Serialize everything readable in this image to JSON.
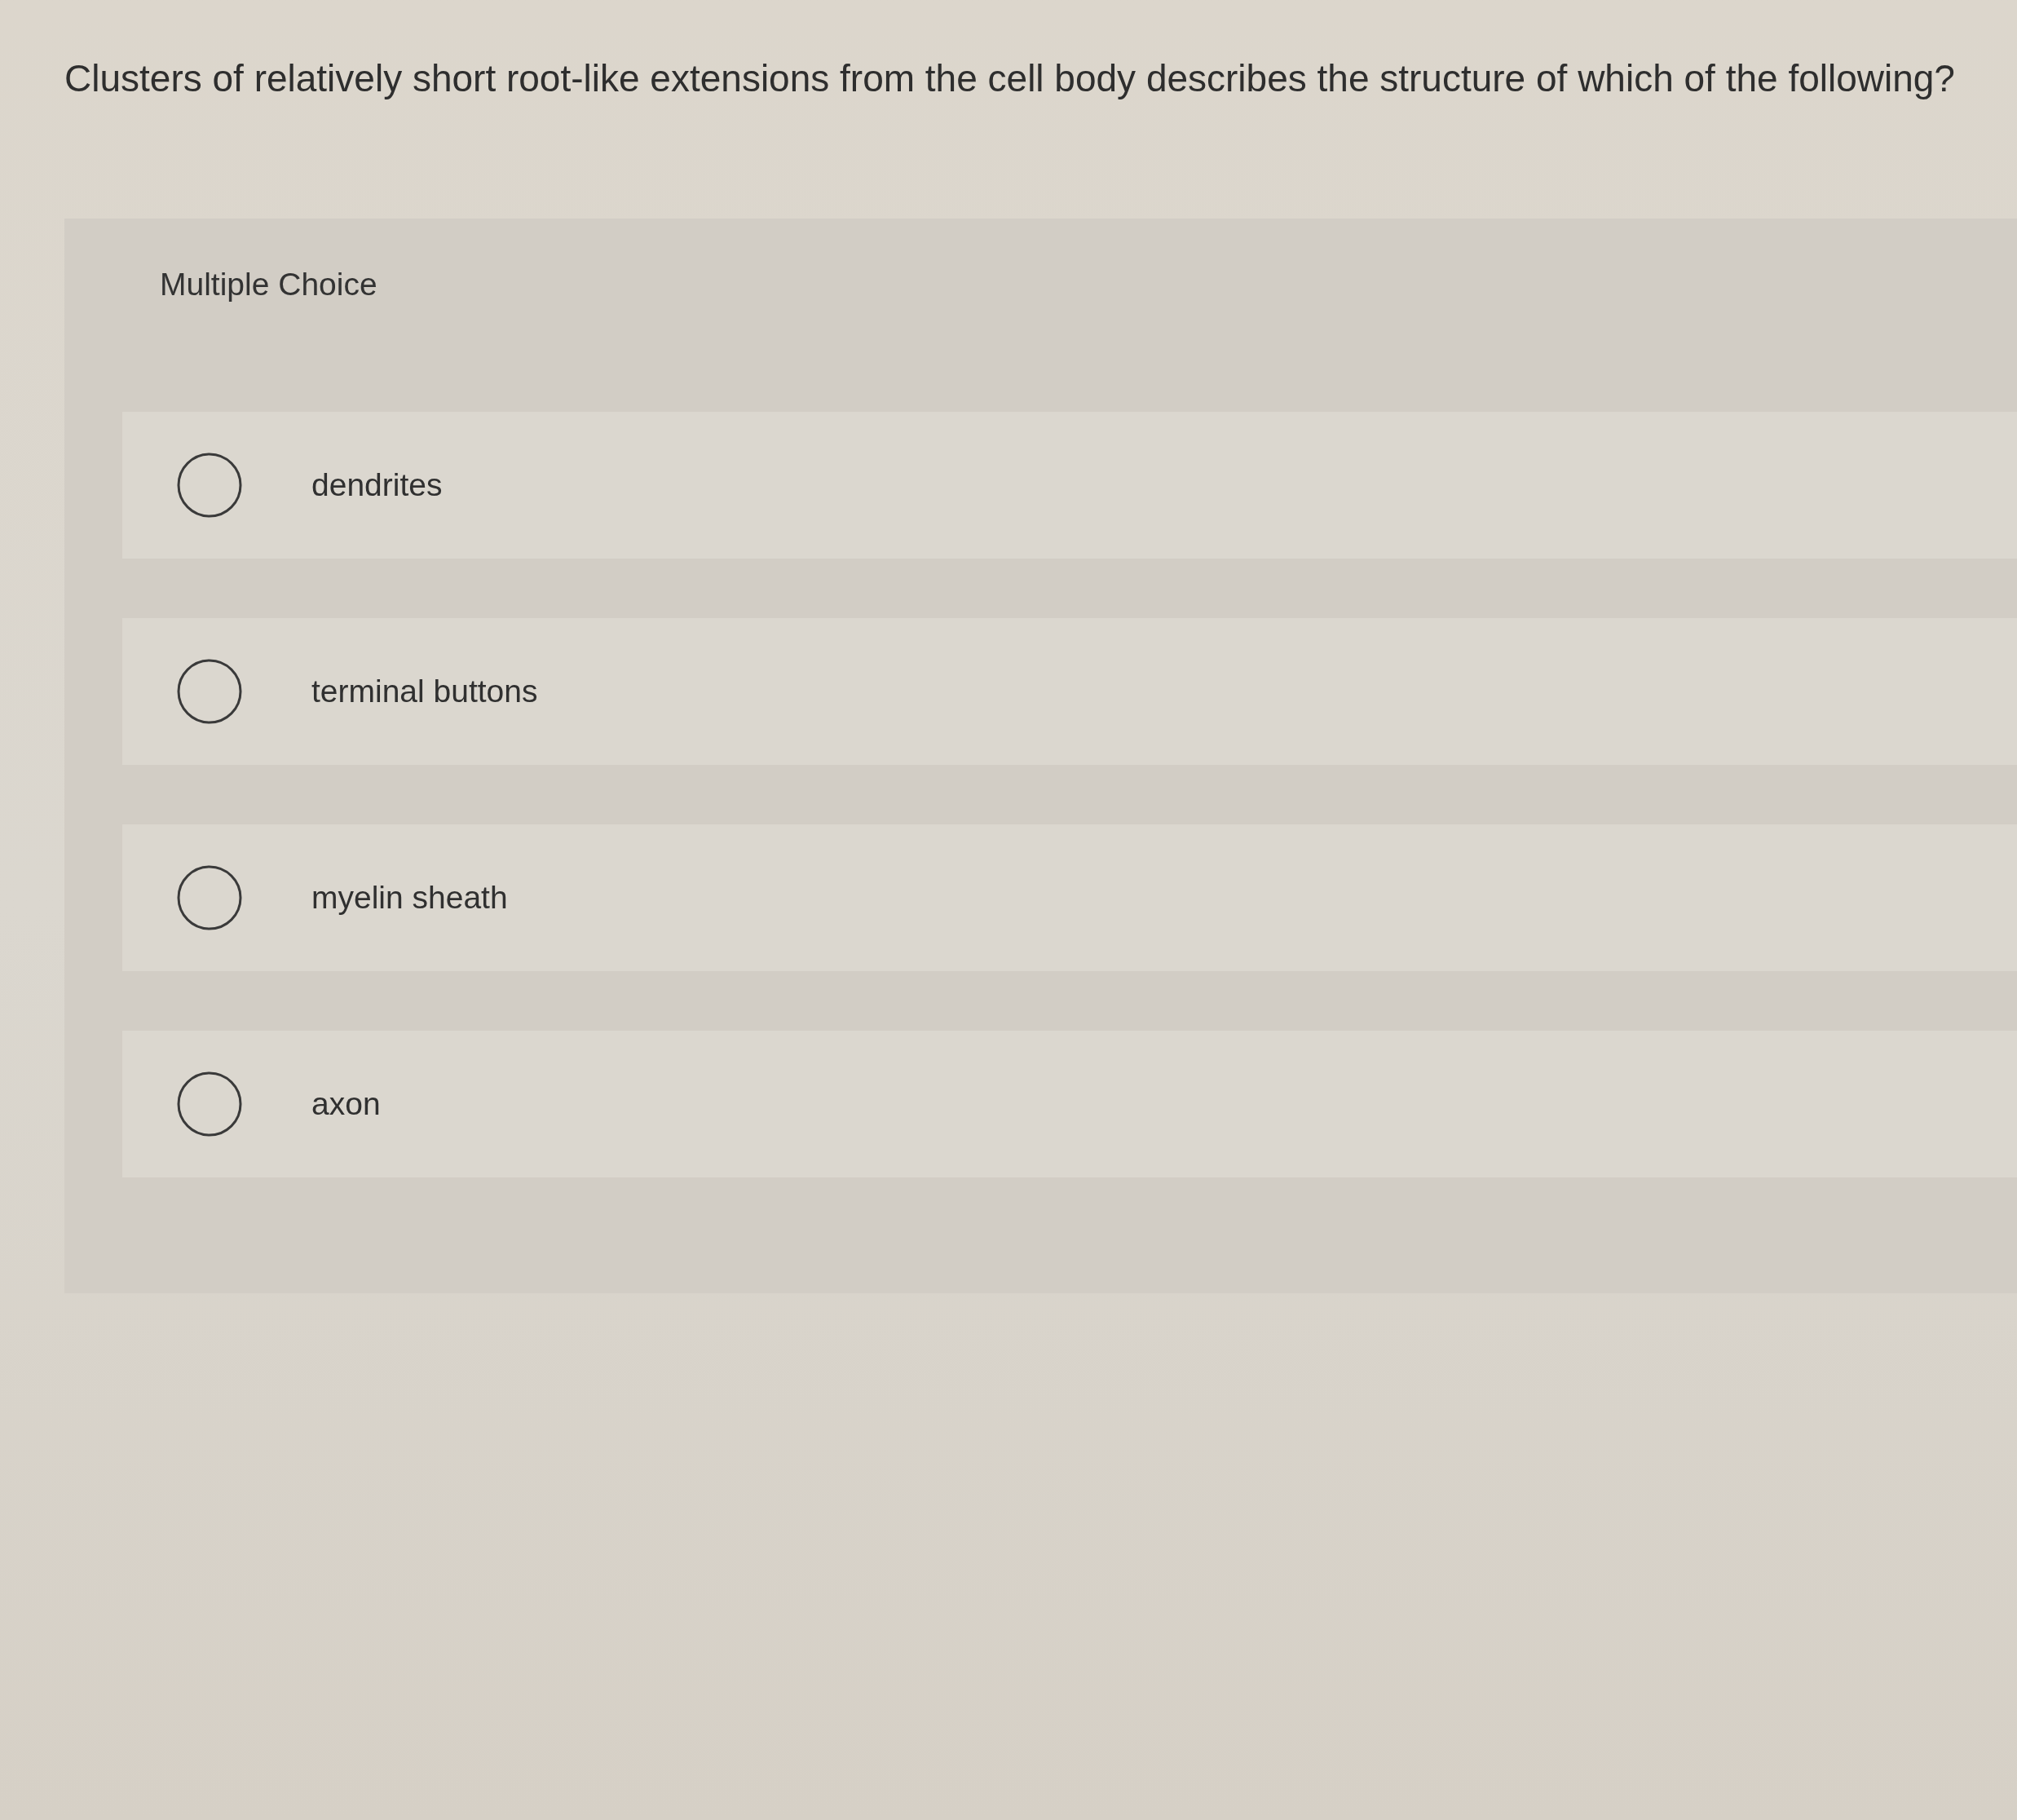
{
  "question": "Clusters of relatively short root-like extensions from the cell body describes the structure of which of the following?",
  "panel": {
    "heading": "Multiple Choice"
  },
  "options": [
    {
      "label": "dendrites",
      "selected": false
    },
    {
      "label": "terminal buttons",
      "selected": false
    },
    {
      "label": "myelin sheath",
      "selected": false
    },
    {
      "label": "axon",
      "selected": false
    }
  ]
}
